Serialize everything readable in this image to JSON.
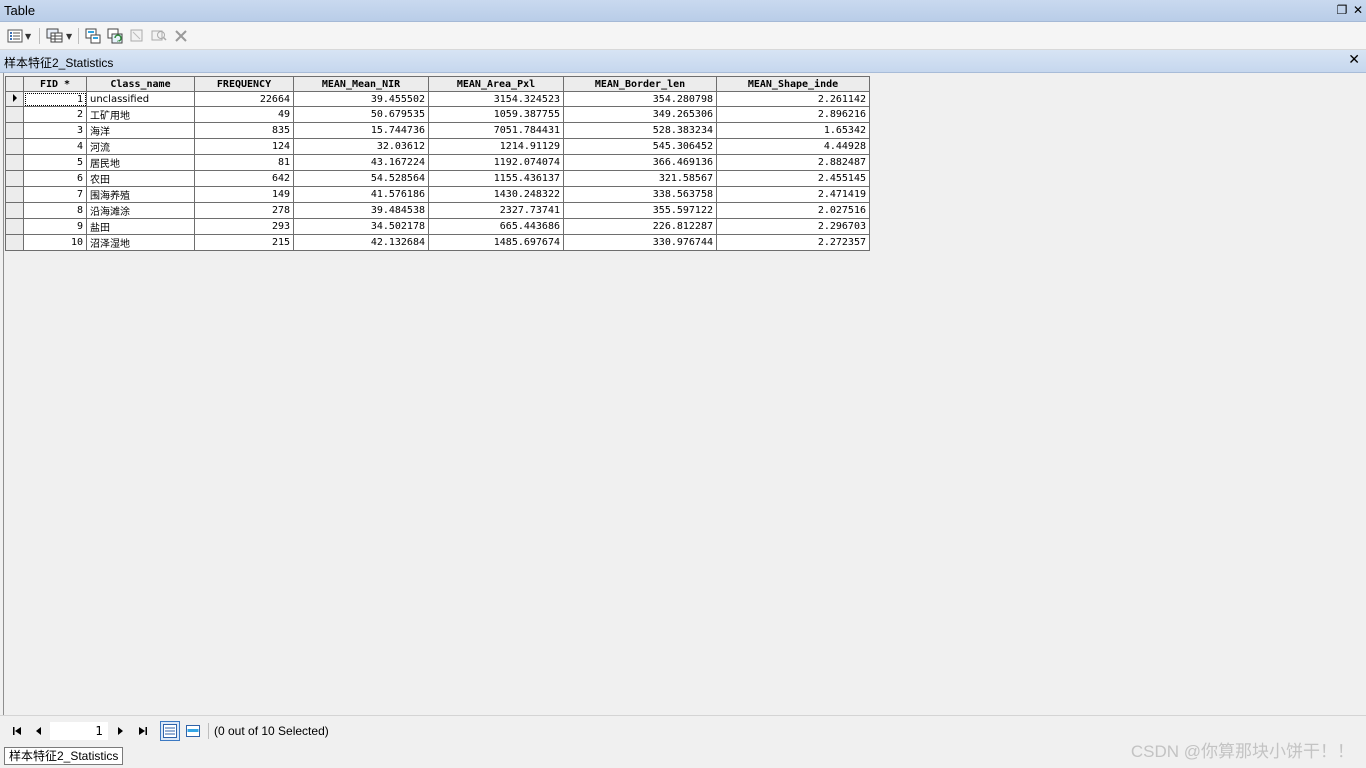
{
  "window": {
    "title": "Table",
    "restore_glyph": "❐",
    "close_glyph": "✕"
  },
  "toolbar": {
    "icons": [
      "table-options-icon",
      "related-tables-icon",
      "select-by-attributes-icon",
      "switch-selection-icon",
      "clear-selection-icon",
      "zoom-to-selected-icon",
      "delete-selected-icon"
    ]
  },
  "table_tab": {
    "title": "样本特征2_Statistics",
    "close_glyph": "✕"
  },
  "grid": {
    "columns": [
      "FID *",
      "Class_name",
      "FREQUENCY",
      "MEAN_Mean_NIR",
      "MEAN_Area_Pxl",
      "MEAN_Border_len",
      "MEAN_Shape_inde"
    ],
    "rows": [
      [
        "1",
        "unclassified",
        "22664",
        "39.455502",
        "3154.324523",
        "354.280798",
        "2.261142"
      ],
      [
        "2",
        "工矿用地",
        "49",
        "50.679535",
        "1059.387755",
        "349.265306",
        "2.896216"
      ],
      [
        "3",
        "海洋",
        "835",
        "15.744736",
        "7051.784431",
        "528.383234",
        "1.65342"
      ],
      [
        "4",
        "河流",
        "124",
        "32.03612",
        "1214.91129",
        "545.306452",
        "4.44928"
      ],
      [
        "5",
        "居民地",
        "81",
        "43.167224",
        "1192.074074",
        "366.469136",
        "2.882487"
      ],
      [
        "6",
        "农田",
        "642",
        "54.528564",
        "1155.436137",
        "321.58567",
        "2.455145"
      ],
      [
        "7",
        "围海养殖",
        "149",
        "41.576186",
        "1430.248322",
        "338.563758",
        "2.471419"
      ],
      [
        "8",
        "沿海滩涂",
        "278",
        "39.484538",
        "2327.73741",
        "355.597122",
        "2.027516"
      ],
      [
        "9",
        "盐田",
        "293",
        "34.502178",
        "665.443686",
        "226.812287",
        "2.296703"
      ],
      [
        "10",
        "沼泽湿地",
        "215",
        "42.132684",
        "1485.697674",
        "330.976744",
        "2.272357"
      ]
    ]
  },
  "status": {
    "current_record": "1",
    "selection": "(0 out of 10 Selected)"
  },
  "bottom_tab": "样本特征2_Statistics",
  "watermark": "CSDN @你算那块小饼干！！"
}
